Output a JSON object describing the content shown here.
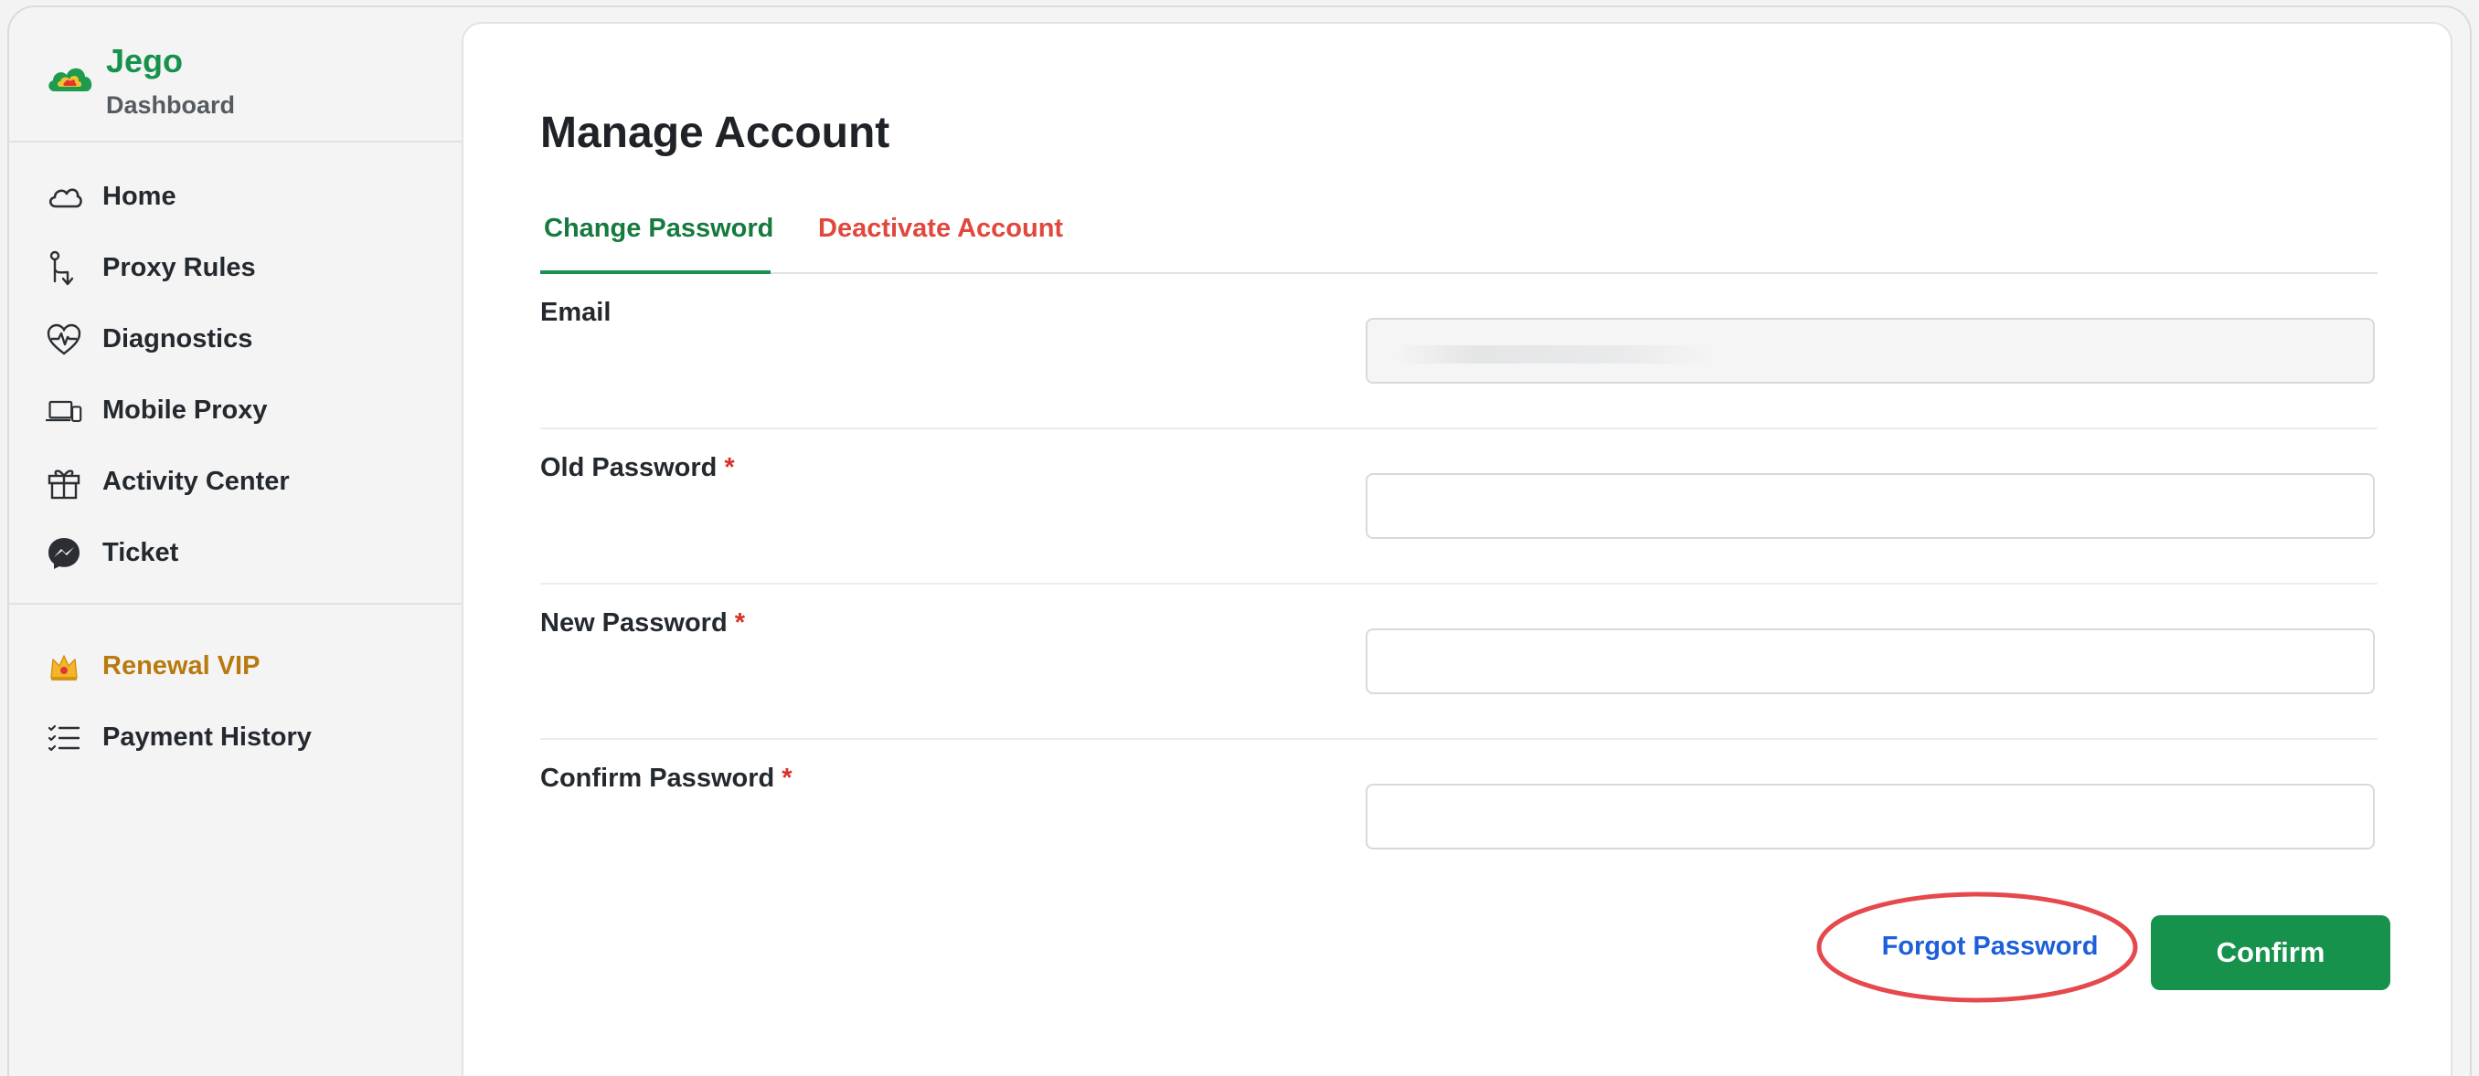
{
  "brand": {
    "name": "Jego",
    "subtitle": "Dashboard",
    "color": "#16924c"
  },
  "sidebar": {
    "items": [
      {
        "label": "Home",
        "icon": "cloud-icon"
      },
      {
        "label": "Proxy Rules",
        "icon": "route-icon"
      },
      {
        "label": "Diagnostics",
        "icon": "heart-pulse-icon"
      },
      {
        "label": "Mobile Proxy",
        "icon": "laptop-phone-icon"
      },
      {
        "label": "Activity Center",
        "icon": "gift-icon"
      },
      {
        "label": "Ticket",
        "icon": "messenger-icon"
      }
    ],
    "secondary": [
      {
        "label": "Renewal VIP",
        "icon": "crown-icon",
        "color": "#b8790e"
      },
      {
        "label": "Payment History",
        "icon": "checklist-icon"
      }
    ]
  },
  "main": {
    "title": "Manage Account",
    "tabs": [
      {
        "label": "Change Password",
        "active": true,
        "color": "#167a3e"
      },
      {
        "label": "Deactivate Account",
        "active": false,
        "color": "#e0473d"
      }
    ],
    "form": {
      "email_label": "Email",
      "email_value": "",
      "old_password_label": "Old Password",
      "new_password_label": "New Password",
      "confirm_password_label": "Confirm Password",
      "required_mark": "*"
    },
    "actions": {
      "forgot_label": "Forgot Password",
      "confirm_label": "Confirm",
      "confirm_color": "#16924c",
      "highlight_color": "#e5484d"
    }
  }
}
